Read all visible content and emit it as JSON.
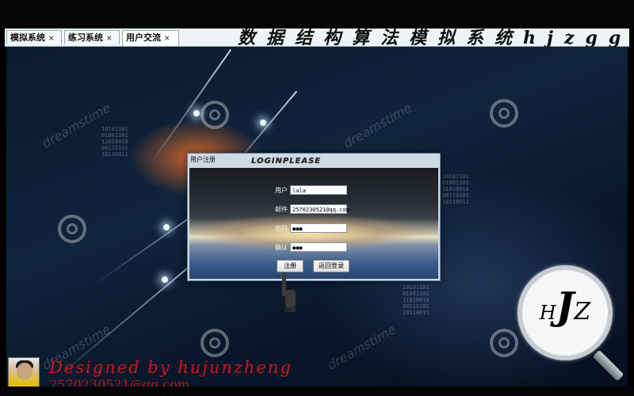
{
  "tabs": [
    {
      "label": "模拟系统",
      "close": "×"
    },
    {
      "label": "练习系统",
      "close": "×"
    },
    {
      "label": "用户交流",
      "close": "×",
      "active": true
    }
  ],
  "banner": "数据结构算法模拟系统hjzgg",
  "background": {
    "watermark": "dreamstime",
    "binary": "10101101\n01001101\n11010010\n00110101\n10110011"
  },
  "dialog": {
    "title": "用户注册",
    "logo_text": "LOGINPLEASE",
    "fields": {
      "user": {
        "label": "用户",
        "value": "lala"
      },
      "email": {
        "label": "邮件",
        "value": "2570230521@qq.com"
      },
      "password": {
        "label": "密码",
        "value": "●●●"
      },
      "confirm": {
        "label": "确认",
        "value": "●●●"
      }
    },
    "register_button": "注册",
    "back_button": "返回登录"
  },
  "logo": {
    "h": "H",
    "j": "J",
    "z": "Z"
  },
  "footer": {
    "designed_by": "Designed by  hujunzheng",
    "email": "2570230521@qq.com"
  },
  "colors": {
    "footer_text": "#d21818",
    "background": "#0b1a2e"
  }
}
